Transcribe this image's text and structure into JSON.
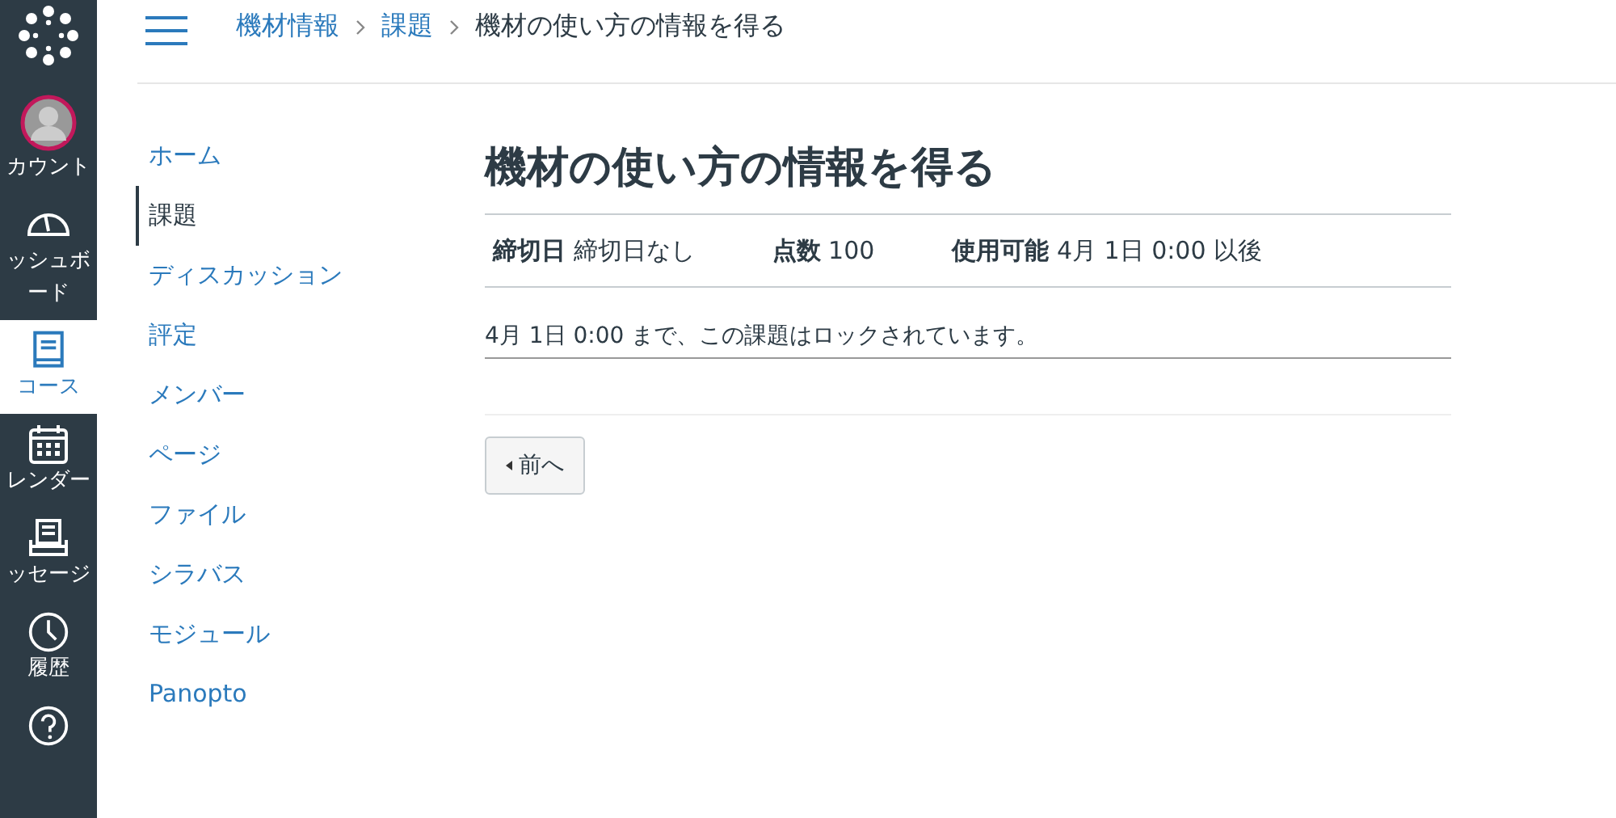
{
  "global_nav": [
    {
      "kind": "logo",
      "selected": false
    },
    {
      "kind": "avatar",
      "label": "カウント",
      "selected": false
    },
    {
      "kind": "dashboard",
      "label": "ッシュボード",
      "selected": false
    },
    {
      "kind": "courses",
      "label": "コース",
      "selected": true
    },
    {
      "kind": "calendar",
      "label": "レンダー",
      "selected": false
    },
    {
      "kind": "inbox",
      "label": "ッセージ",
      "selected": false
    },
    {
      "kind": "history",
      "label": "履歴",
      "selected": false
    },
    {
      "kind": "help",
      "selected": false
    }
  ],
  "breadcrumb": [
    "機材情報",
    "課題",
    "機材の使い方の情報を得る"
  ],
  "course_nav": [
    {
      "label": "ホーム",
      "selected": false
    },
    {
      "label": "課題",
      "selected": true
    },
    {
      "label": "ディスカッション",
      "selected": false
    },
    {
      "label": "評定",
      "selected": false
    },
    {
      "label": "メンバー",
      "selected": false
    },
    {
      "label": "ページ",
      "selected": false
    },
    {
      "label": "ファイル",
      "selected": false
    },
    {
      "label": "シラバス",
      "selected": false
    },
    {
      "label": "モジュール",
      "selected": false
    },
    {
      "label": "Panopto",
      "selected": false
    }
  ],
  "assignment": {
    "title": "機材の使い方の情報を得る",
    "details": [
      {
        "label": "締切日",
        "value": "締切日なし"
      },
      {
        "label": "点数",
        "value": "100"
      },
      {
        "label": "使用可能",
        "value": "4月 1日 0:00 以後"
      }
    ],
    "lock_message": "4月 1日 0:00 まで、この課題はロックされています。",
    "previous_button": "前へ"
  }
}
